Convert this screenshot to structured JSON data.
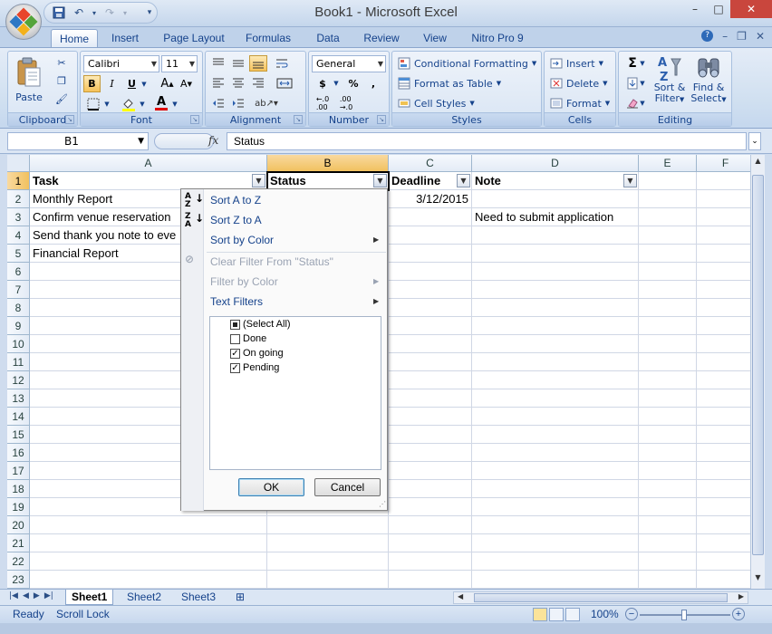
{
  "window": {
    "title": "Book1 - Microsoft Excel",
    "min": "–",
    "max": "□",
    "close": "✕"
  },
  "tabs": [
    "Home",
    "Insert",
    "Page Layout",
    "Formulas",
    "Data",
    "Review",
    "View",
    "Nitro Pro 9"
  ],
  "ribbon": {
    "clipboard": {
      "label": "Clipboard",
      "paste": "Paste"
    },
    "font": {
      "label": "Font",
      "name": "Calibri",
      "size": "11",
      "bold": "B",
      "italic": "I",
      "underline": "U"
    },
    "alignment": {
      "label": "Alignment"
    },
    "number": {
      "label": "Number",
      "format": "General",
      "currency": "$",
      "percent": "%",
      "comma": ",",
      "inc_dec": ".0 .00"
    },
    "styles": {
      "label": "Styles",
      "conditional": "Conditional Formatting",
      "format_table": "Format as Table",
      "cell_styles": "Cell Styles"
    },
    "cells": {
      "label": "Cells",
      "insert": "Insert",
      "delete": "Delete",
      "format": "Format"
    },
    "editing": {
      "label": "Editing",
      "sum": "Σ",
      "sort": "Sort &",
      "filter": "Filter",
      "find": "Find &",
      "select": "Select"
    }
  },
  "formula_bar": {
    "name_box": "B1",
    "fx": "fx",
    "value": "Status"
  },
  "columns": [
    "A",
    "B",
    "C",
    "D",
    "E",
    "F"
  ],
  "rows": [
    "1",
    "2",
    "3",
    "4",
    "5",
    "6",
    "7",
    "8",
    "9",
    "10",
    "11",
    "12",
    "13",
    "14",
    "15",
    "16",
    "17",
    "18",
    "19",
    "20",
    "21",
    "22",
    "23"
  ],
  "cells": {
    "A1": "Task",
    "B1": "Status",
    "C1": "Deadline",
    "D1": "Note",
    "A2": "Monthly Report",
    "C2": "3/12/2015",
    "A3": "Confirm venue reservation",
    "D3": "Need to submit application",
    "A4": "Send thank you note to eve",
    "A5": "Financial Report"
  },
  "filter_menu": {
    "sort_az": "Sort A to Z",
    "sort_za": "Sort Z to A",
    "sort_color": "Sort by Color",
    "clear_filter": "Clear Filter From \"Status\"",
    "filter_color": "Filter by Color",
    "text_filters": "Text Filters",
    "items": [
      {
        "label": "(Select All)",
        "state": "partial"
      },
      {
        "label": "Done",
        "state": "unchecked"
      },
      {
        "label": "On going",
        "state": "checked"
      },
      {
        "label": "Pending",
        "state": "checked"
      }
    ],
    "ok": "OK",
    "cancel": "Cancel"
  },
  "sheets": [
    "Sheet1",
    "Sheet2",
    "Sheet3"
  ],
  "status": {
    "ready": "Ready",
    "scroll_lock": "Scroll Lock",
    "zoom": "100%"
  },
  "colors": {
    "accent": "#15428b",
    "selected_header": "#f1c15f",
    "close": "#c9463d"
  }
}
